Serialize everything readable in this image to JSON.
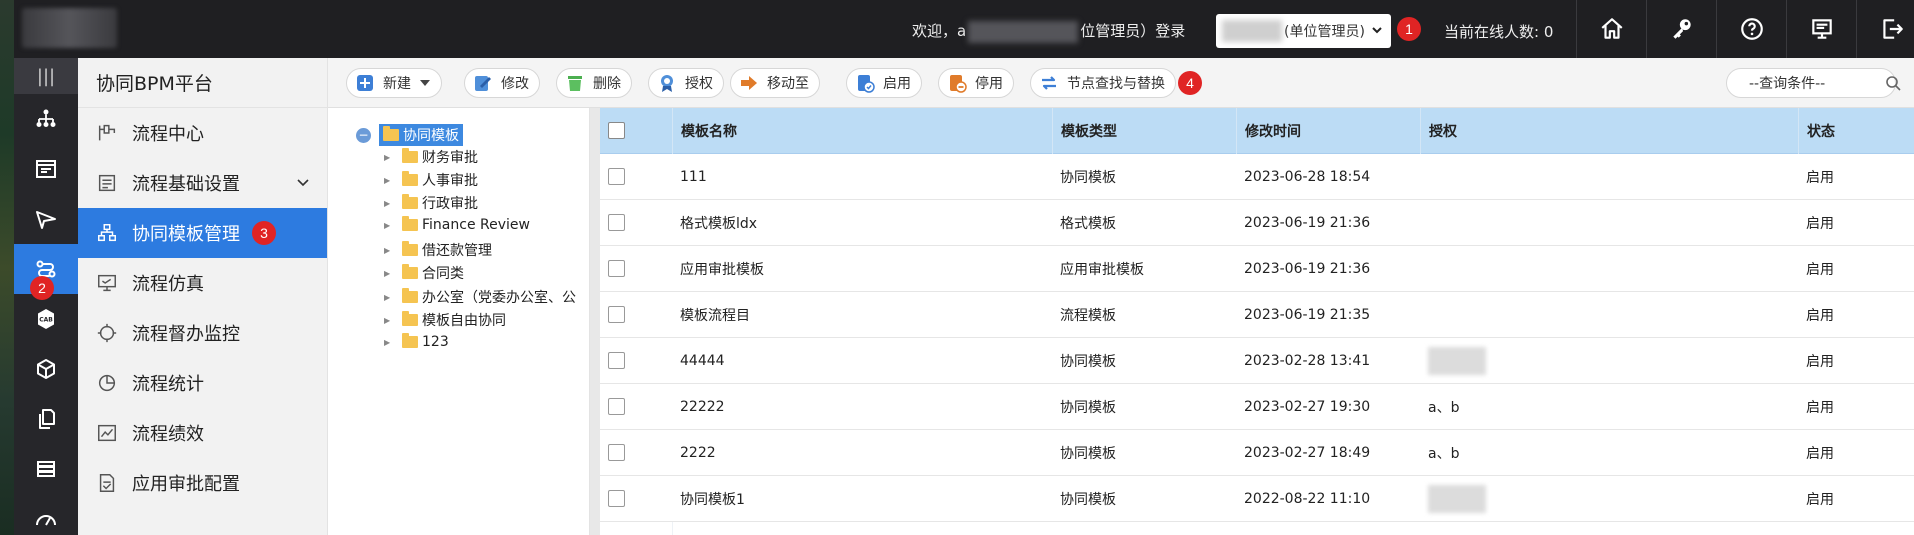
{
  "topbar": {
    "welcome_prefix": "欢迎，a",
    "welcome_suffix": "位管理员）登录",
    "unit_select_value": "(单位管理员)",
    "online_label": "当前在线人数: 0",
    "badge_1": "1",
    "icons": [
      "home-icon",
      "key-icon",
      "help-icon",
      "monitor-icon",
      "logout-icon"
    ]
  },
  "rail": {
    "toggle": "|||",
    "items": [
      "org-chart-icon",
      "calendar-icon",
      "send-icon",
      "flow-link-icon",
      "cab-icon",
      "cube-icon",
      "documents-icon",
      "layers-icon",
      "gauge-icon"
    ],
    "badge_2": "2"
  },
  "subnav": {
    "title": "协同BPM平台",
    "items": [
      {
        "label": "流程中心"
      },
      {
        "label": "流程基础设置"
      },
      {
        "label": "协同模板管理"
      },
      {
        "label": "流程仿真"
      },
      {
        "label": "流程督办监控"
      },
      {
        "label": "流程统计"
      },
      {
        "label": "流程绩效"
      },
      {
        "label": "应用审批配置"
      }
    ],
    "badge_3": "3"
  },
  "toolbar": {
    "buttons": [
      {
        "label": "新建"
      },
      {
        "label": "修改"
      },
      {
        "label": "删除"
      },
      {
        "label": "授权"
      },
      {
        "label": "移动至"
      },
      {
        "label": "启用"
      },
      {
        "label": "停用"
      },
      {
        "label": "节点查找与替换"
      }
    ],
    "badge_4": "4",
    "query_placeholder": "--查询条件--"
  },
  "tree": {
    "root": "协同模板",
    "nodes": [
      {
        "label": "财务审批",
        "expandable": true
      },
      {
        "label": "人事审批",
        "expandable": true
      },
      {
        "label": "行政审批",
        "expandable": true
      },
      {
        "label": "Finance Review",
        "expandable": true
      },
      {
        "label": "借还款管理",
        "expandable": true
      },
      {
        "label": "合同类",
        "expandable": true
      },
      {
        "label": "办公室（党委办公室、公",
        "expandable": true
      },
      {
        "label": "模板自由协同",
        "expandable": true
      },
      {
        "label": "123",
        "expandable": true
      }
    ]
  },
  "table": {
    "columns": [
      "模板名称",
      "模板类型",
      "修改时间",
      "授权",
      "状态"
    ],
    "rows": [
      {
        "name": "111",
        "type": "协同模板",
        "time": "2023-06-28 18:54",
        "auth": "",
        "status": "启用"
      },
      {
        "name": "格式模板ldx",
        "type": "格式模板",
        "time": "2023-06-19 21:36",
        "auth": "",
        "status": "启用"
      },
      {
        "name": "应用审批模板",
        "type": "应用审批模板",
        "time": "2023-06-19 21:36",
        "auth": "",
        "status": "启用"
      },
      {
        "name": "模板流程目",
        "type": "流程模板",
        "time": "2023-06-19 21:35",
        "auth": "",
        "status": "启用"
      },
      {
        "name": "44444",
        "type": "协同模板",
        "time": "2023-02-28 13:41",
        "auth": "",
        "status": "启用"
      },
      {
        "name": "22222",
        "type": "协同模板",
        "time": "2023-02-27 19:30",
        "auth": "a、b",
        "status": "启用"
      },
      {
        "name": "2222",
        "type": "协同模板",
        "time": "2023-02-27 18:49",
        "auth": "a、b",
        "status": "启用"
      },
      {
        "name": "协同模板1",
        "type": "协同模板",
        "time": "2022-08-22 11:10",
        "auth": "",
        "status": "启用"
      }
    ]
  },
  "colors": {
    "topbar_bg": "#1f1f22",
    "rail_bg": "#26262a",
    "accent_blue": "#2d7be0",
    "badge_red": "#e02424",
    "header_blue": "#bcdcf5"
  }
}
